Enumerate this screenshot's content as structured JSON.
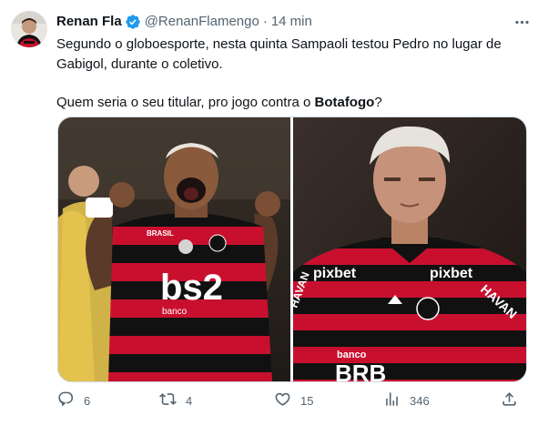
{
  "author": {
    "name": "Renan Fla",
    "handle": "@RenanFlamengo",
    "separator": "·",
    "time": "14 min",
    "verified": true,
    "verified_color": "#1d9bf0"
  },
  "text": {
    "line1": "Segundo o globoesporte, nesta quinta Sampaoli testou Pedro no lugar de Gabigol, durante o coletivo.",
    "line2_prefix": "Quem seria o seu titular, pro jogo contra o ",
    "line2_bold": "Botafogo",
    "line2_suffix": "?"
  },
  "media": {
    "left_photo": {
      "sponsor": "bs2",
      "sponsor_sub": "banco",
      "kit_brand": "BRASIL"
    },
    "right_photo": {
      "sponsor_left": "pixbet",
      "sponsor_right": "pixbet",
      "sleeve_text": "HAVAN",
      "sleeve_text_left": "HAVAN",
      "bottom_sub": "banco",
      "bottom_sponsor": "BRB"
    },
    "kit_colors": {
      "red": "#c8102e",
      "black": "#111111"
    }
  },
  "actions": {
    "reply_count": "6",
    "retweet_count": "4",
    "like_count": "15",
    "views_count": "346"
  },
  "icons": {
    "more": "more-dots-icon",
    "reply": "reply-icon",
    "retweet": "retweet-icon",
    "like": "heart-icon",
    "views": "views-chart-icon",
    "share": "share-icon"
  }
}
